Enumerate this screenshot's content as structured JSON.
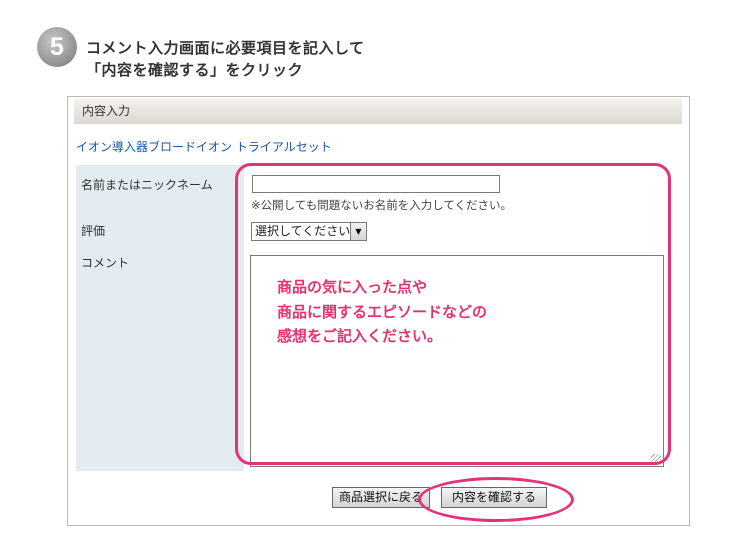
{
  "step": {
    "number": "5",
    "title_line1": "コメント入力画面に必要項目を記入して",
    "title_line2": "「内容を確認する」をクリック"
  },
  "form": {
    "header": "内容入力",
    "product_link": "イオン導入器ブロードイオン トライアルセット",
    "name_label": "名前またはニックネーム",
    "name_value": "",
    "name_note": "※公開しても問題ないお名前を入力してください。",
    "rating_label": "評価",
    "rating_selected": "選択してください",
    "comment_label": "コメント",
    "comment_value": ""
  },
  "annotation": {
    "line1": "商品の気に入った点や",
    "line2": "商品に関するエピソードなどの",
    "line3": "感想をご記入ください。",
    "color": "#e4327a"
  },
  "buttons": {
    "back": "商品選択に戻る",
    "confirm": "内容を確認する"
  }
}
